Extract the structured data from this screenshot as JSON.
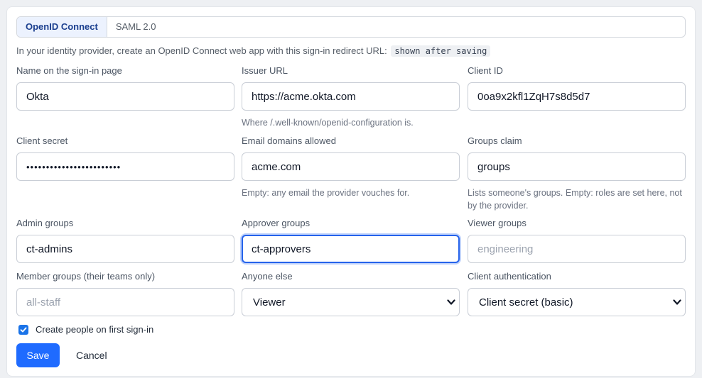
{
  "tabs": [
    {
      "label": "OpenID Connect",
      "active": true
    },
    {
      "label": "SAML 2.0",
      "active": false
    }
  ],
  "hint": {
    "text": "In your identity provider, create an OpenID Connect web app with this sign-in redirect URL:",
    "code": "shown after saving"
  },
  "fields": {
    "name": {
      "label": "Name on the sign-in page",
      "value": "Okta"
    },
    "issuer": {
      "label": "Issuer URL",
      "value": "https://acme.okta.com",
      "help": "Where /.well-known/openid-configuration is."
    },
    "client_id": {
      "label": "Client ID",
      "value": "0oa9x2kfl1ZqH7s8d5d7"
    },
    "client_secret": {
      "label": "Client secret",
      "value": "••••••••••••••••••••••••"
    },
    "email_domains": {
      "label": "Email domains allowed",
      "value": "acme.com",
      "help": "Empty: any email the provider vouches for."
    },
    "groups_claim": {
      "label": "Groups claim",
      "value": "groups",
      "help": "Lists someone's groups. Empty: roles are set here, not by the provider."
    },
    "admin_groups": {
      "label": "Admin groups",
      "value": "ct-admins"
    },
    "approver_groups": {
      "label": "Approver groups",
      "value": "ct-approvers"
    },
    "viewer_groups": {
      "label": "Viewer groups",
      "value": "",
      "placeholder": "engineering"
    },
    "member_groups": {
      "label": "Member groups (their teams only)",
      "value": "",
      "placeholder": "all-staff"
    },
    "anyone_else": {
      "label": "Anyone else",
      "selected": "Viewer"
    },
    "client_auth": {
      "label": "Client authentication",
      "selected": "Client secret (basic)"
    }
  },
  "create_people": {
    "label": "Create people on first sign-in",
    "checked": true
  },
  "buttons": {
    "save": "Save",
    "cancel": "Cancel"
  },
  "colors": {
    "primary": "#1f6bff",
    "focus": "#2563eb",
    "checkbox": "#1a73e8"
  }
}
